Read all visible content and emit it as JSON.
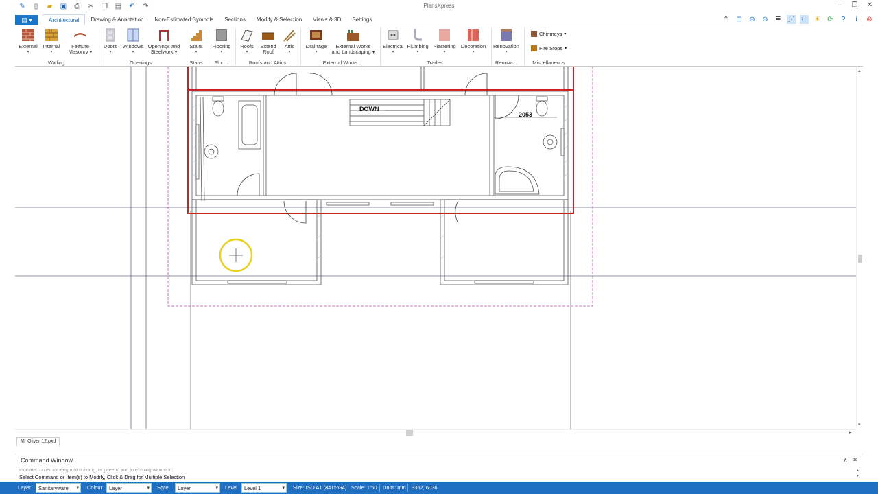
{
  "app": {
    "title": "PlansXpress"
  },
  "quick_access": [
    "app-logo-icon",
    "new-file-icon",
    "open-folder-icon",
    "save-icon",
    "print-icon",
    "cut-icon",
    "copy-icon",
    "paste-icon",
    "undo-icon",
    "redo-icon"
  ],
  "tabs": {
    "app_menu": "",
    "items": [
      "Architectural",
      "Drawing & Annotation",
      "Non-Estimated Symbols",
      "Sections",
      "Modify & Selection",
      "Views & 3D",
      "Settings"
    ],
    "active": "Architectural"
  },
  "ribbon": {
    "external": "External",
    "internal": "Internal",
    "feature_masonry_1": "Feature",
    "feature_masonry_2": "Masonry",
    "doors": "Doors",
    "windows": "Windows",
    "openings_1": "Openings and",
    "openings_2": "Steelwork",
    "stairs": "Stairs",
    "flooring": "Flooring",
    "roofs": "Roofs",
    "extend_roof_1": "Extend",
    "extend_roof_2": "Roof",
    "attic": "Attic",
    "drainage": "Drainage",
    "ext_works_1": "External Works",
    "ext_works_2": "and Landscaping",
    "electrical": "Electrical",
    "plumbing": "Plumbing",
    "plastering": "Plastering",
    "decoration": "Decoration",
    "renovation": "Renovation",
    "chimneys": "Chimneys",
    "fire_stops": "Fire Stops",
    "groups": {
      "walling": "Walling",
      "openings": "Openings",
      "stairs": "Stairs",
      "floo": "Floo...",
      "roofs_attics": "Roofs and Attics",
      "external_works": "External Works",
      "trades": "Trades",
      "renova": "Renova...",
      "misc": "Miscellaneous"
    }
  },
  "drawing": {
    "stair_label": "DOWN",
    "dimension": "2053"
  },
  "document_tab": "Mr Oliver 12.pxd",
  "command_window": {
    "title": "Command Window",
    "previous": "Indicate corner for length of building, or [J]ee to join to existing wall/roof :",
    "current": "Select Command or Item(s) to Modify, Click & Drag for Multiple Selection"
  },
  "statusbar": {
    "layer_label": "Layer",
    "layer_value": "Sanitaryware",
    "colour_label": "Colour",
    "colour_value": "Layer",
    "style_label": "Style",
    "style_value": "Layer",
    "level_label": "Level",
    "level_value": "Level 1",
    "size": "Size: ISO A1 (841x594)",
    "scale": "Scale: 1:50",
    "units": "Units: mm",
    "coords": "3352, 6036"
  }
}
